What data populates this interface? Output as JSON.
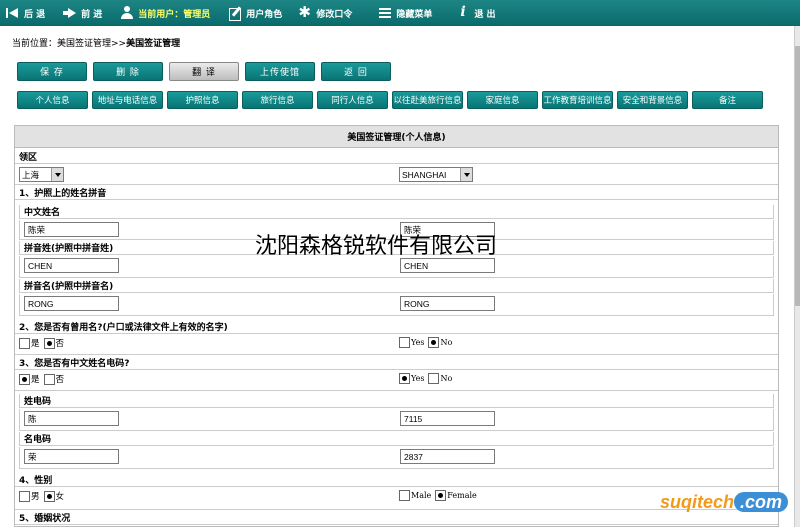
{
  "toolbar": {
    "back": "后 退",
    "forward": "前 进",
    "current_user": "当前用户：管理员",
    "user_role": "用户角色",
    "change_password": "修改口令",
    "hide_menu": "隐藏菜单",
    "exit": "退 出"
  },
  "breadcrumb": {
    "prefix": "当前位置：美国签证管理>>",
    "current": "美国签证管理"
  },
  "actions": [
    "保 存",
    "删 除",
    "翻 译",
    "上传使馆",
    "返 回"
  ],
  "tabs": [
    "个人信息",
    "地址与电话信息",
    "护照信息",
    "旅行信息",
    "同行人信息",
    "以往赴美旅行信息",
    "家庭信息",
    "工作教育培训信息",
    "安全和背景信息",
    "备注"
  ],
  "form": {
    "title": "美国签证管理(个人信息)",
    "consular_label": "领区",
    "consular_cn": "上海",
    "consular_en": "SHANGHAI",
    "sec1": "1、护照上的姓名拼音",
    "cn_name_label": "中文姓名",
    "cn_name_cn": "陈荣",
    "cn_name_en": "陈荣",
    "surname_label": "拼音姓(护照中拼音姓)",
    "surname_cn": "CHEN",
    "surname_en": "CHEN",
    "given_label": "拼音名(护照中拼音名)",
    "given_cn": "RONG",
    "given_en": "RONG",
    "sec2": "2、您是否有曾用名?(户口或法律文件上有效的名字)",
    "sec2_yes": "是",
    "sec2_no": "否",
    "sec2_yes_en": "Yes",
    "sec2_no_en": "No",
    "sec3": "3、您是否有中文姓名电码?",
    "sec3_yes": "是",
    "sec3_no": "否",
    "sec3_yes_en": "Yes",
    "sec3_no_en": "No",
    "surname_code_label": "姓电码",
    "surname_code_cn": "陈",
    "surname_code_en": "7115",
    "given_code_label": "名电码",
    "given_code_cn": "荣",
    "given_code_en": "2837",
    "sec4": "4、性别",
    "male": "男",
    "female": "女",
    "male_en": "Male",
    "female_en": "Female",
    "sec5": "5、婚姻状况"
  },
  "watermark": "沈阳森格锐软件有限公司",
  "logo": {
    "name": "suqitech",
    "tld": ".com"
  }
}
